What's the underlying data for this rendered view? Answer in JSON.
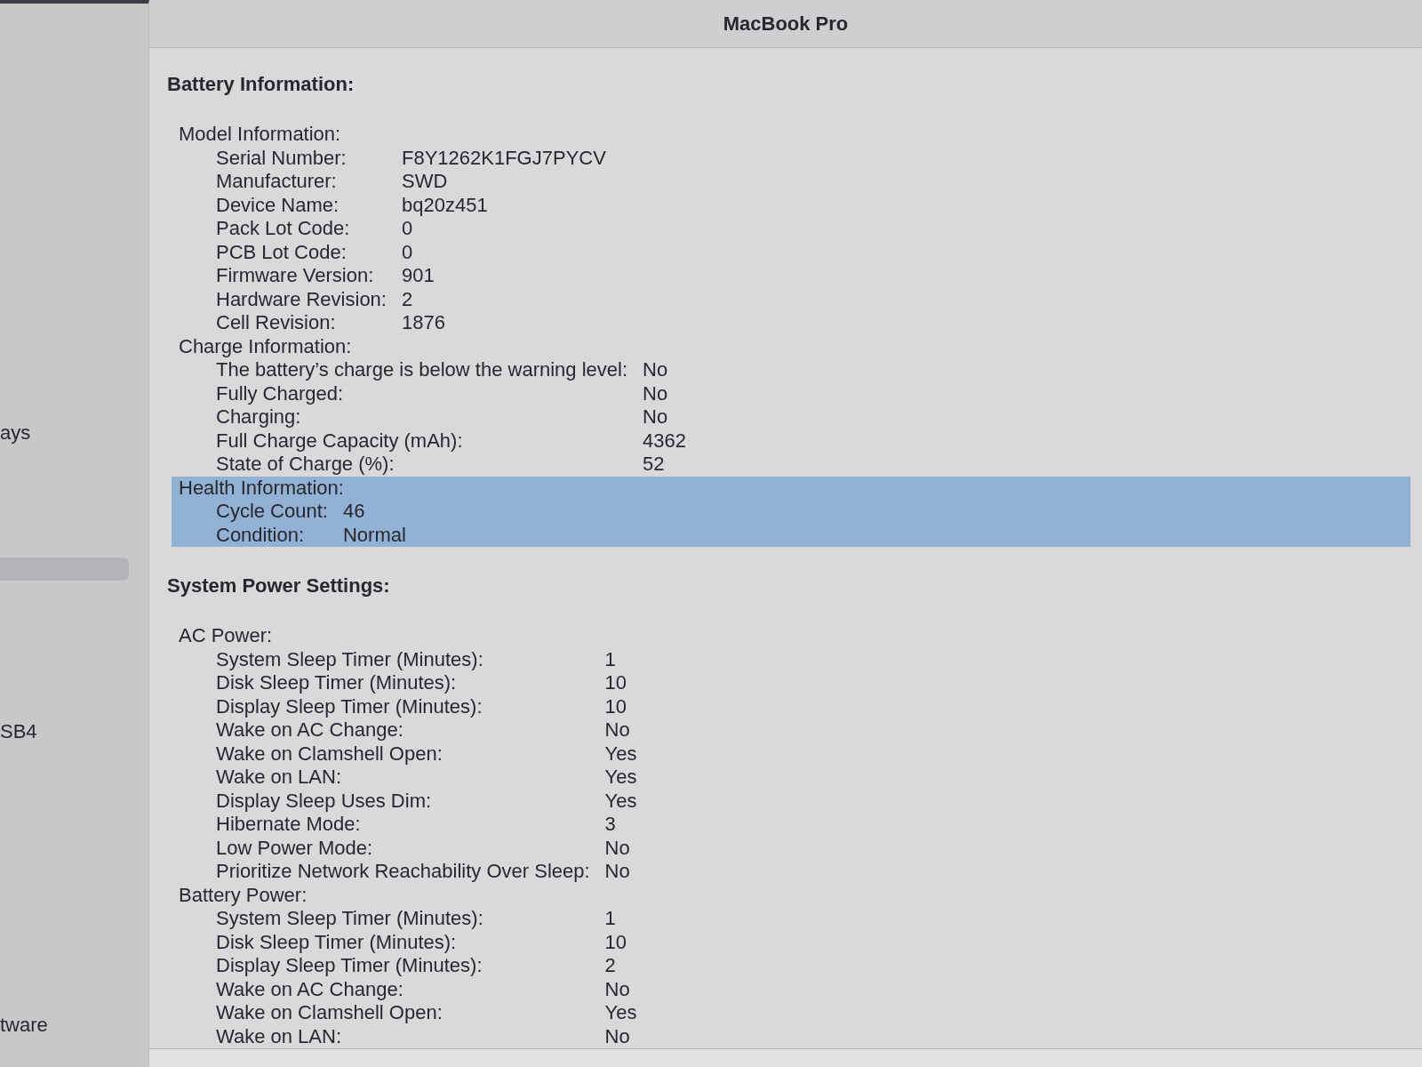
{
  "window": {
    "title": "MacBook Pro"
  },
  "sidebar": {
    "items": [
      {
        "label": "ays",
        "selected": false
      },
      {
        "selected": true
      },
      {
        "label": "SB4",
        "selected": false
      },
      {
        "label": "tware",
        "selected": false
      }
    ]
  },
  "sections": [
    {
      "title": "Battery Information:",
      "children": [
        {
          "title": "Model Information:",
          "selected": false,
          "children": [
            {
              "label": "Serial Number:",
              "value": "F8Y1262K1FGJ7PYCV"
            },
            {
              "label": "Manufacturer:",
              "value": "SWD"
            },
            {
              "label": "Device Name:",
              "value": "bq20z451"
            },
            {
              "label": "Pack Lot Code:",
              "value": "0"
            },
            {
              "label": "PCB Lot Code:",
              "value": "0"
            },
            {
              "label": "Firmware Version:",
              "value": "901"
            },
            {
              "label": "Hardware Revision:",
              "value": "2"
            },
            {
              "label": "Cell Revision:",
              "value": "1876"
            }
          ]
        },
        {
          "title": "Charge Information:",
          "selected": false,
          "children": [
            {
              "label": "The battery’s charge is below the warning level:",
              "value": "No"
            },
            {
              "label": "Fully Charged:",
              "value": "No"
            },
            {
              "label": "Charging:",
              "value": "No"
            },
            {
              "label": "Full Charge Capacity (mAh):",
              "value": "4362"
            },
            {
              "label": "State of Charge (%):",
              "value": "52"
            }
          ]
        },
        {
          "title": "Health Information:",
          "selected": true,
          "children": [
            {
              "label": "Cycle Count:",
              "value": "46"
            },
            {
              "label": "Condition:",
              "value": "Normal"
            }
          ]
        }
      ]
    },
    {
      "title": "System Power Settings:",
      "children": [
        {
          "title": "AC Power:",
          "selected": false,
          "children": [
            {
              "label": "System Sleep Timer (Minutes):",
              "value": "1"
            },
            {
              "label": "Disk Sleep Timer (Minutes):",
              "value": "10"
            },
            {
              "label": "Display Sleep Timer (Minutes):",
              "value": "10"
            },
            {
              "label": "Wake on AC Change:",
              "value": "No"
            },
            {
              "label": "Wake on Clamshell Open:",
              "value": "Yes"
            },
            {
              "label": "Wake on LAN:",
              "value": "Yes"
            },
            {
              "label": "Display Sleep Uses Dim:",
              "value": "Yes"
            },
            {
              "label": "Hibernate Mode:",
              "value": "3"
            },
            {
              "label": "Low Power Mode:",
              "value": "No"
            },
            {
              "label": "Prioritize Network Reachability Over Sleep:",
              "value": "No"
            }
          ]
        },
        {
          "title": "Battery Power:",
          "selected": false,
          "children": [
            {
              "label": "System Sleep Timer (Minutes):",
              "value": "1"
            },
            {
              "label": "Disk Sleep Timer (Minutes):",
              "value": "10"
            },
            {
              "label": "Display Sleep Timer (Minutes):",
              "value": "2"
            },
            {
              "label": "Wake on AC Change:",
              "value": "No"
            },
            {
              "label": "Wake on Clamshell Open:",
              "value": "Yes"
            },
            {
              "label": "Wake on LAN:",
              "value": "No"
            }
          ]
        }
      ]
    }
  ]
}
